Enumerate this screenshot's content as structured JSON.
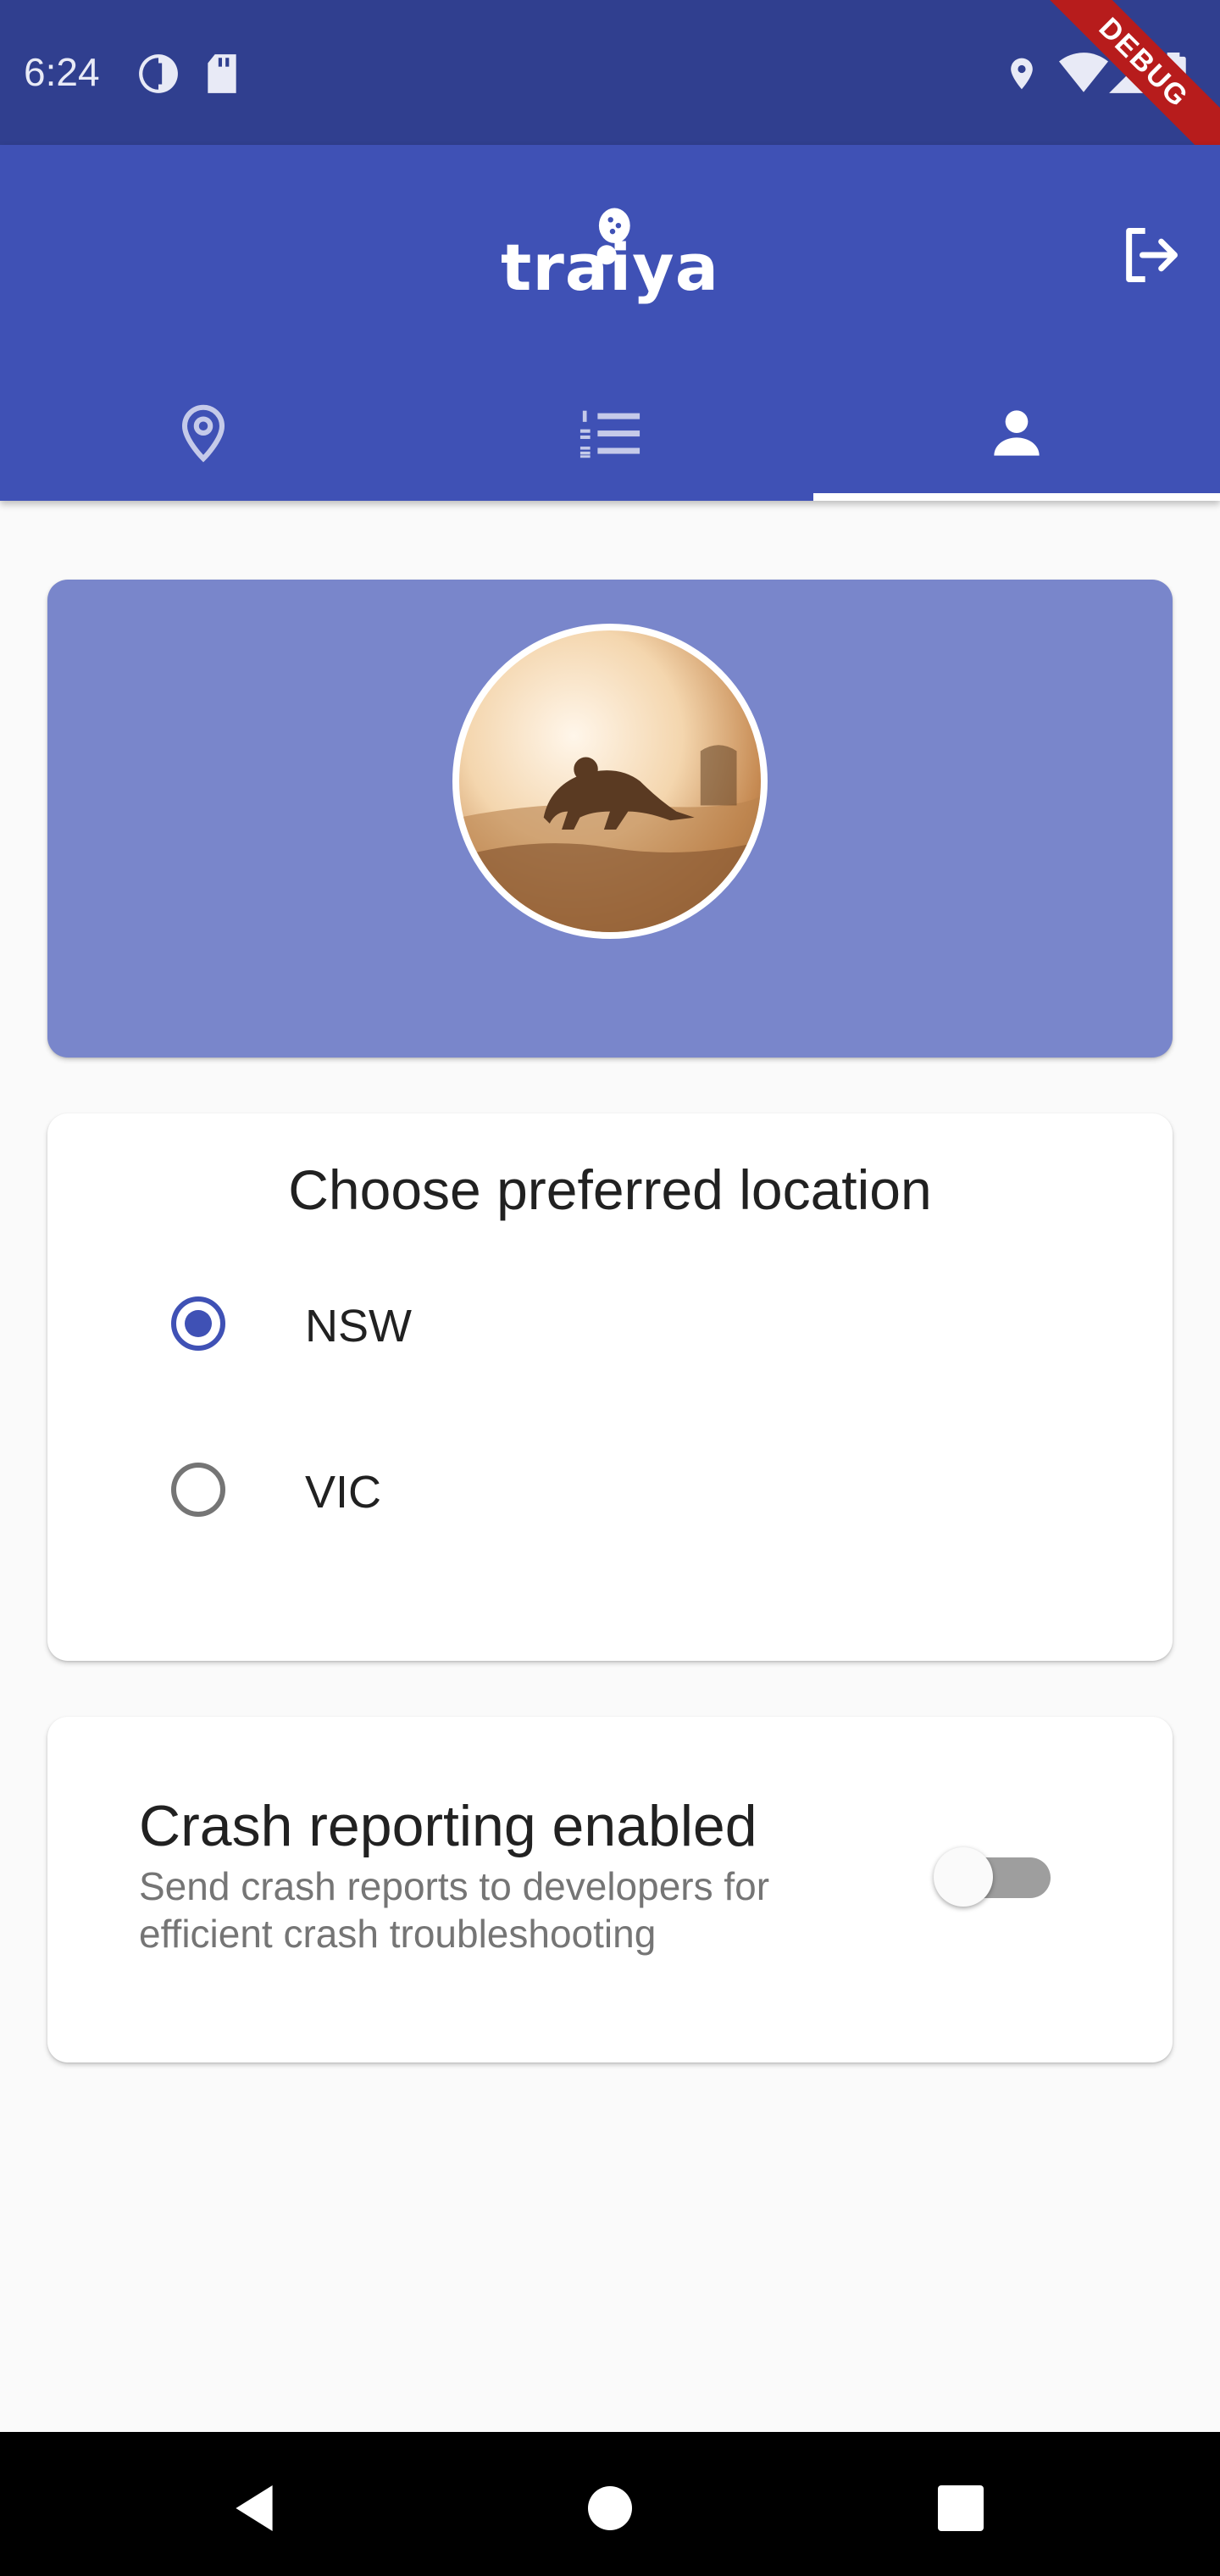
{
  "status_bar": {
    "time": "6:24",
    "icons": [
      "sync-icon",
      "sd-card-icon",
      "location-icon",
      "wifi-icon",
      "signal-icon",
      "battery-icon"
    ],
    "debug_label": "DEBUG",
    "background": "#303f8f"
  },
  "app_bar": {
    "logo_text": "traiya",
    "logo_icon": "hiking-boot-icon",
    "logout_icon": "logout-icon",
    "background": "#3f51b5"
  },
  "tabs": [
    {
      "icon": "location-pin-icon",
      "selected": false
    },
    {
      "icon": "numbered-list-icon",
      "selected": false
    },
    {
      "icon": "person-icon",
      "selected": true
    }
  ],
  "profile": {
    "avatar": "kangaroo-photo",
    "card_color": "#7986cb"
  },
  "location": {
    "title": "Choose preferred location",
    "options": [
      {
        "label": "NSW",
        "checked": true
      },
      {
        "label": "VIC",
        "checked": false
      }
    ]
  },
  "crash_reporting": {
    "title": "Crash reporting enabled",
    "subtitle": "Send crash reports to developers for efficient crash troubleshooting",
    "enabled": false
  },
  "nav_bar": {
    "buttons": [
      "back-icon",
      "home-icon",
      "recents-icon"
    ]
  }
}
